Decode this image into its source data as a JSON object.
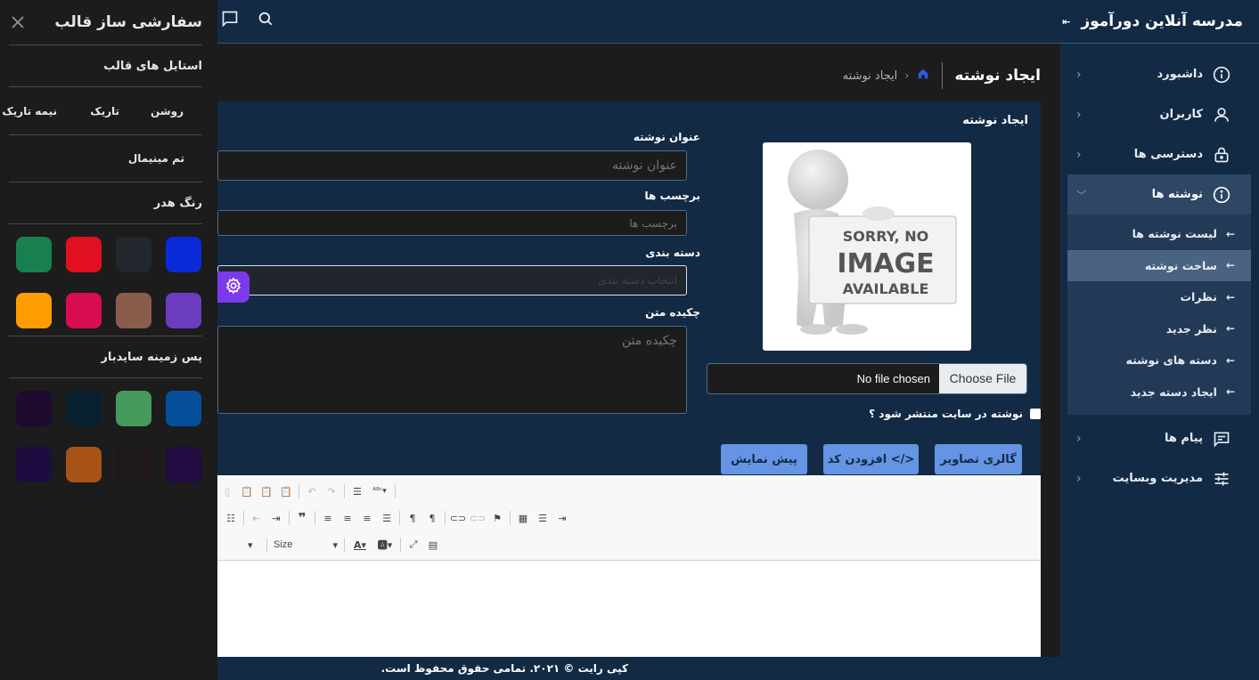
{
  "sidebar": {
    "brand": "مدرسه آنلاین دورآموز",
    "collapse_icon": "⇤",
    "items": [
      {
        "label": "داشبورد",
        "icon": "info-icon"
      },
      {
        "label": "کاربران",
        "icon": "user-icon"
      },
      {
        "label": "دسترسی ها",
        "icon": "lock-icon"
      },
      {
        "label": "نوشته ها",
        "icon": "info-icon",
        "expanded": true
      },
      {
        "label": "پیام ها",
        "icon": "message-icon"
      },
      {
        "label": "مدیریت وبسایت",
        "icon": "sliders-icon"
      }
    ],
    "submenu": [
      {
        "label": "لیست نوشته ها"
      },
      {
        "label": "ساخت نوشته",
        "active": true
      },
      {
        "label": "نظرات"
      },
      {
        "label": "نظر جدید"
      },
      {
        "label": "دسته های نوشته"
      },
      {
        "label": "ایجاد دسته جدید"
      }
    ]
  },
  "header": {
    "page_title": "ایجاد نوشته",
    "breadcrumb_current": "ایجاد نوشته"
  },
  "form": {
    "card_title": "ایجاد نوشته",
    "title_label": "عنوان نوشته",
    "title_placeholder": "عنوان نوشته",
    "tags_label": "برچسب ها",
    "tags_placeholder": "برچسب ها",
    "category_label": "دسته بندی",
    "category_placeholder": "انتخاب دسته بندی",
    "excerpt_label": "چکیده متن",
    "excerpt_placeholder": "چکیده متن",
    "image_placeholder": {
      "line1": "SORRY, NO",
      "line2": "IMAGE",
      "line3": "AVAILABLE"
    },
    "file_button": "Choose File",
    "file_status": "No file chosen",
    "publish_label": "نوشته در سایت منتشر شود ؟",
    "publish_checked": false,
    "buttons": {
      "gallery": "گالری تصاویر",
      "add_code": "افزودن کد </>",
      "preview": "پیش نمایش"
    }
  },
  "editor": {
    "size_combo": "Size"
  },
  "footer": {
    "copyright": "کپی رایت © ۲۰۲۱. تمامی حقوق محفوظ است."
  },
  "customizer": {
    "title": "سفارشی ساز قالب",
    "styles_heading": "استایل های قالب",
    "style_light": "روشن",
    "style_dark": "تاریک",
    "style_semidark": "نیمه تاریک",
    "minimal_theme": "تم مینیمال",
    "header_color_heading": "رنگ هدر",
    "header_colors": [
      "#0a2ad8",
      "#22272e",
      "#e01020",
      "#188050",
      "#6c3cc0",
      "#8a5c4c",
      "#d80c50",
      "#ff9c00"
    ],
    "sidebar_bg_heading": "پس زمینه سایدبار",
    "sidebar_colors": [
      "#064f9a",
      "#459a5c",
      "#06202e",
      "#200a30",
      "#230a40",
      "#1e1818",
      "#a85416",
      "#1d0c40"
    ]
  },
  "colors": {
    "primary_dark": "#132a45",
    "accent_button": "#6494e3",
    "gear_button": "#7c3aed"
  }
}
